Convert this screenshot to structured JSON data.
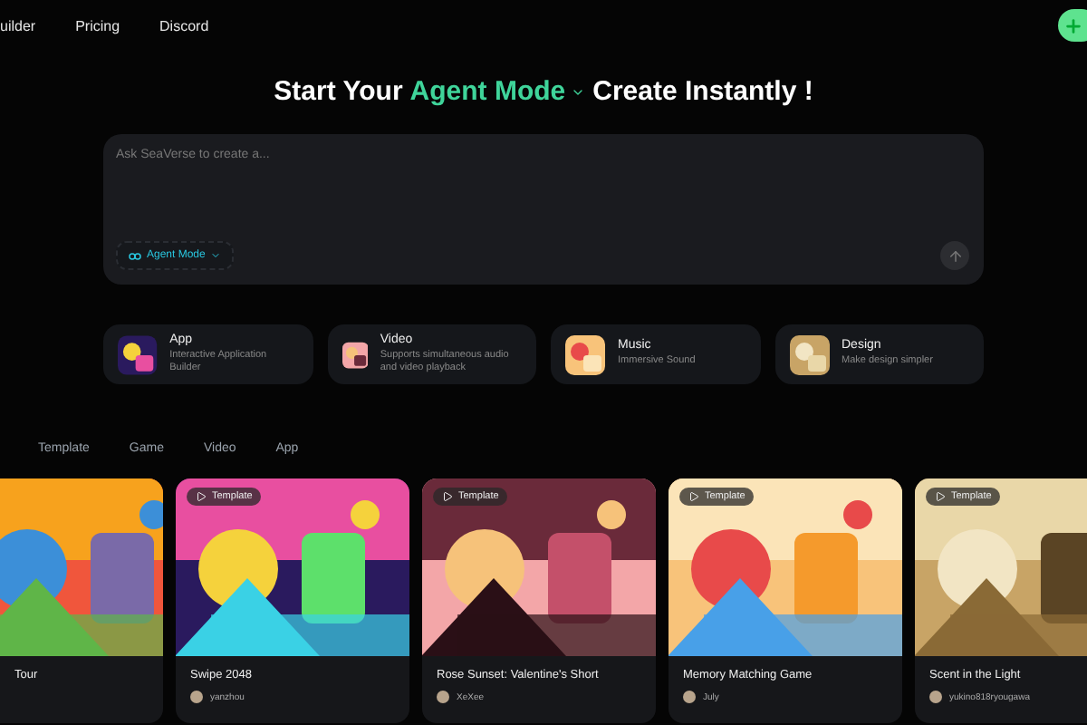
{
  "nav": {
    "links": [
      "uilder",
      "Pricing",
      "Discord"
    ]
  },
  "headline": {
    "lead": "Start Your",
    "mode": "Agent Mode",
    "tail": "Create Instantly !"
  },
  "prompt": {
    "placeholder": "Ask SeaVerse to create a...",
    "mode_button": "Agent Mode"
  },
  "categories": [
    {
      "title": "App",
      "description": "Interactive Application Builder"
    },
    {
      "title": "Video",
      "description": "Supports simultaneous audio and video playback"
    },
    {
      "title": "Music",
      "description": "Immersive Sound"
    },
    {
      "title": "Design",
      "description": "Make design simpler"
    }
  ],
  "tabs": [
    {
      "label": "Template",
      "selected": false
    },
    {
      "label": "Game",
      "selected": false
    },
    {
      "label": "Video",
      "selected": false
    },
    {
      "label": "App",
      "selected": false
    }
  ],
  "cards": [
    {
      "title": "Tour"
    },
    {
      "badge": "Template",
      "title": "Swipe 2048",
      "author": "yanzhou"
    },
    {
      "badge": "Template",
      "title": "Rose Sunset: Valentine's Short",
      "author": "XeXee"
    },
    {
      "badge": "Template",
      "title": "Memory Matching Game",
      "author": "July"
    },
    {
      "badge": "Template",
      "title": "Scent in the Light",
      "author": "yukino818ryougawa"
    }
  ]
}
